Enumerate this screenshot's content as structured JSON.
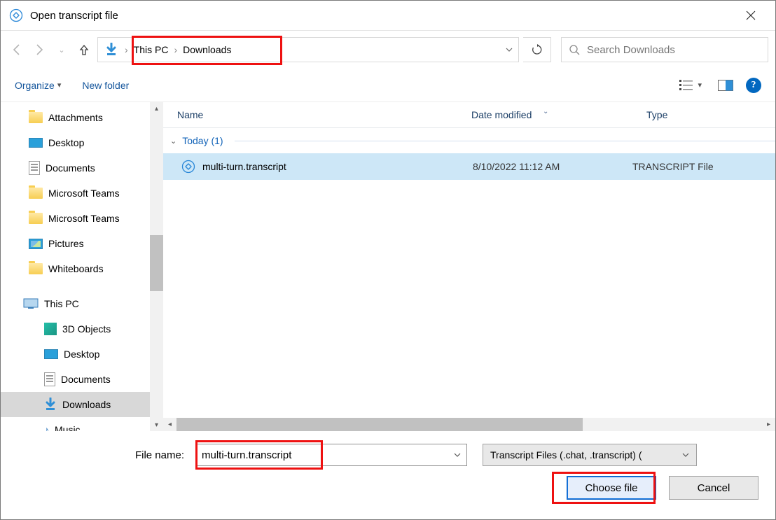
{
  "title": "Open transcript file",
  "breadcrumb": {
    "root": "This PC",
    "current": "Downloads"
  },
  "search": {
    "placeholder": "Search Downloads"
  },
  "toolbar": {
    "organize": "Organize",
    "new_folder": "New folder"
  },
  "tree": {
    "items": [
      {
        "label": "Attachments",
        "icon": "folder"
      },
      {
        "label": "Desktop",
        "icon": "desktop"
      },
      {
        "label": "Documents",
        "icon": "document"
      },
      {
        "label": "Microsoft Teams",
        "icon": "folder"
      },
      {
        "label": "Microsoft Teams",
        "icon": "folder"
      },
      {
        "label": "Pictures",
        "icon": "picture"
      },
      {
        "label": "Whiteboards",
        "icon": "folder"
      }
    ],
    "pc": "This PC",
    "pc_children": [
      {
        "label": "3D Objects",
        "icon": "cube"
      },
      {
        "label": "Desktop",
        "icon": "desktop"
      },
      {
        "label": "Documents",
        "icon": "document"
      },
      {
        "label": "Downloads",
        "icon": "download",
        "selected": true
      },
      {
        "label": "Music",
        "icon": "music"
      }
    ]
  },
  "columns": {
    "name": "Name",
    "date": "Date modified",
    "type": "Type"
  },
  "group": {
    "label": "Today (1)"
  },
  "files": [
    {
      "name": "multi-turn.transcript",
      "date": "8/10/2022 11:12 AM",
      "type": "TRANSCRIPT File"
    }
  ],
  "bottom": {
    "filename_label": "File name:",
    "filename_value": "multi-turn.transcript",
    "filter": "Transcript Files (.chat, .transcript) (",
    "choose": "Choose file",
    "cancel": "Cancel"
  }
}
